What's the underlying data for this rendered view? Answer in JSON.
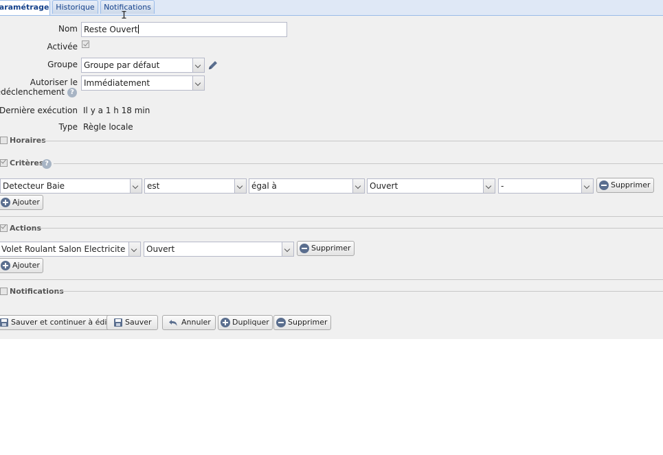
{
  "tabs": [
    {
      "label": "Paramétrage"
    },
    {
      "label": "Historique"
    },
    {
      "label": "Notifications"
    }
  ],
  "form": {
    "nom_label": "Nom",
    "nom_value": "Reste Ouvert",
    "activee_label": "Activée",
    "activee_checked": true,
    "groupe_label": "Groupe",
    "groupe_value": "Groupe par défaut",
    "autoriser_label_line1": "Autoriser le",
    "autoriser_label_line2": "redéclenchement",
    "autoriser_value": "Immédiatement",
    "derniere_label": "Dernière exécution",
    "derniere_value": "Il y a 1 h 18 min",
    "type_label": "Type",
    "type_value": "Règle locale"
  },
  "sections": {
    "horaires": "Horaires",
    "criteres": "Critères",
    "actions": "Actions",
    "notifications": "Notifications"
  },
  "criteres_row": {
    "device": "Detecteur Baie",
    "operator": "est",
    "comparison": "égal à",
    "value": "Ouvert",
    "extra": "-",
    "delete_label": "Supprimer"
  },
  "actions_row": {
    "device": "Volet Roulant Salon Electricite",
    "value": "Ouvert",
    "delete_label": "Supprimer"
  },
  "add_label": "Ajouter",
  "footer": {
    "save_continue": "Sauver et continuer à éditer",
    "save": "Sauver",
    "cancel": "Annuler",
    "duplicate": "Dupliquer",
    "delete": "Supprimer"
  },
  "colors": {
    "tab_text": "#15428b",
    "icon_blue": "#5a6e8e",
    "panel_bg": "#f0f0f0"
  }
}
